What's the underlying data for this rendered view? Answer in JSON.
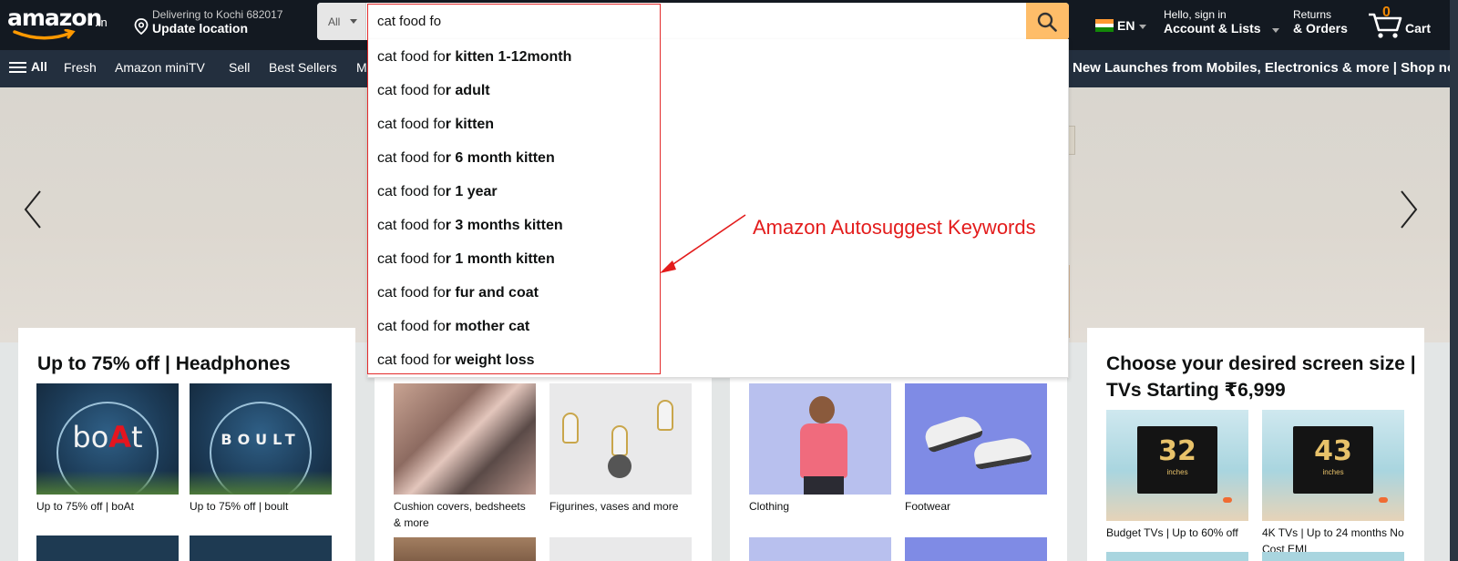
{
  "header": {
    "logo_text": "amazon",
    "logo_tld": ".in",
    "location_line1": "Delivering to Kochi 682017",
    "location_line2": "Update location",
    "search_category": "All",
    "search_value": "cat food fo",
    "language": "EN",
    "account_line1": "Hello, sign in",
    "account_line2": "Account & Lists",
    "returns_line1": "Returns",
    "returns_line2": "& Orders",
    "cart_count": "0",
    "cart_label": "Cart",
    "colors": {
      "header_bg": "#131921",
      "nav_bg": "#232f3e",
      "search_button": "#febd69",
      "cart_count": "#f08804"
    }
  },
  "nav": {
    "all_label": "All",
    "items": [
      "Fresh",
      "Amazon miniTV",
      "Sell",
      "Best Sellers",
      "M"
    ],
    "promo": "New Launches from Mobiles, Electronics & more | Shop now"
  },
  "suggestions": [
    {
      "prefix": "cat food fo",
      "rest": "r kitten 1-12month"
    },
    {
      "prefix": "cat food fo",
      "rest": "r adult"
    },
    {
      "prefix": "cat food fo",
      "rest": "r kitten"
    },
    {
      "prefix": "cat food fo",
      "rest": "r 6 month kitten"
    },
    {
      "prefix": "cat food fo",
      "rest": "r 1 year"
    },
    {
      "prefix": "cat food fo",
      "rest": "r 3 months kitten"
    },
    {
      "prefix": "cat food fo",
      "rest": "r 1 month kitten"
    },
    {
      "prefix": "cat food fo",
      "rest": "r fur and coat"
    },
    {
      "prefix": "cat food fo",
      "rest": "r mother cat"
    },
    {
      "prefix": "cat food fo",
      "rest": "r weight loss"
    }
  ],
  "annotation": {
    "text": "Amazon Autosuggest Keywords",
    "color": "#e31c1c"
  },
  "cards": {
    "headphones": {
      "title": "Up to 75% off | Headphones",
      "tiles": [
        {
          "caption": "Up to 75% off | boAt",
          "brand": "boAt"
        },
        {
          "caption": "Up to 75% off | boult",
          "brand": "BOULT"
        }
      ]
    },
    "home": {
      "tiles": [
        {
          "caption": "Cushion covers, bedsheets & more"
        },
        {
          "caption": "Figurines, vases and more"
        }
      ]
    },
    "fashion": {
      "tiles": [
        {
          "caption": "Clothing"
        },
        {
          "caption": "Footwear"
        }
      ]
    },
    "tvs": {
      "title": "Choose your desired screen size | TVs Starting ₹6,999",
      "tiles": [
        {
          "caption": "Budget TVs | Up to 60% off",
          "size": "32",
          "unit": "inches"
        },
        {
          "caption": "4K TVs | Up to 24 months No Cost EMI",
          "size": "43",
          "unit": "inches"
        }
      ]
    }
  }
}
